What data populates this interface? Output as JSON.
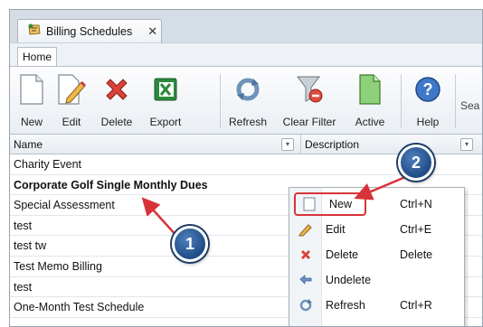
{
  "window": {
    "tab_label": "Billing Schedules",
    "tab_close": "✕"
  },
  "ribbon": {
    "tab_home": "Home",
    "buttons": [
      {
        "label": "New",
        "icon": "new-document-icon"
      },
      {
        "label": "Edit",
        "icon": "edit-document-icon"
      },
      {
        "label": "Delete",
        "icon": "delete-x-icon"
      },
      {
        "label": "Export",
        "icon": "excel-export-icon"
      },
      {
        "label": "Refresh",
        "icon": "refresh-icon"
      },
      {
        "label": "Clear Filter",
        "icon": "clear-filter-icon"
      },
      {
        "label": "Active",
        "icon": "active-document-icon"
      },
      {
        "label": "Help",
        "icon": "help-icon"
      }
    ],
    "search_label": "Sea"
  },
  "grid": {
    "columns": [
      "Name",
      "Description"
    ],
    "rows": [
      {
        "name": "Charity Event"
      },
      {
        "name": "Corporate Golf Single Monthly Dues",
        "bold": true
      },
      {
        "name": "Special Assessment"
      },
      {
        "name": "test"
      },
      {
        "name": "test tw"
      },
      {
        "name": "Test Memo Billing"
      },
      {
        "name": "test"
      },
      {
        "name": "One-Month Test Schedule"
      }
    ]
  },
  "context_menu": {
    "items": [
      {
        "label": "New",
        "shortcut": "Ctrl+N",
        "icon": "new-document-icon"
      },
      {
        "label": "Edit",
        "shortcut": "Ctrl+E",
        "icon": "pencil-icon"
      },
      {
        "label": "Delete",
        "shortcut": "Delete",
        "icon": "delete-x-icon"
      },
      {
        "label": "Undelete",
        "shortcut": "",
        "icon": "undo-icon"
      },
      {
        "label": "Refresh",
        "shortcut": "Ctrl+R",
        "icon": "refresh-icon"
      }
    ]
  },
  "callouts": [
    "1",
    "2"
  ],
  "colors": {
    "accent_red": "#d8333a",
    "callout_blue": "#1f4c86"
  }
}
